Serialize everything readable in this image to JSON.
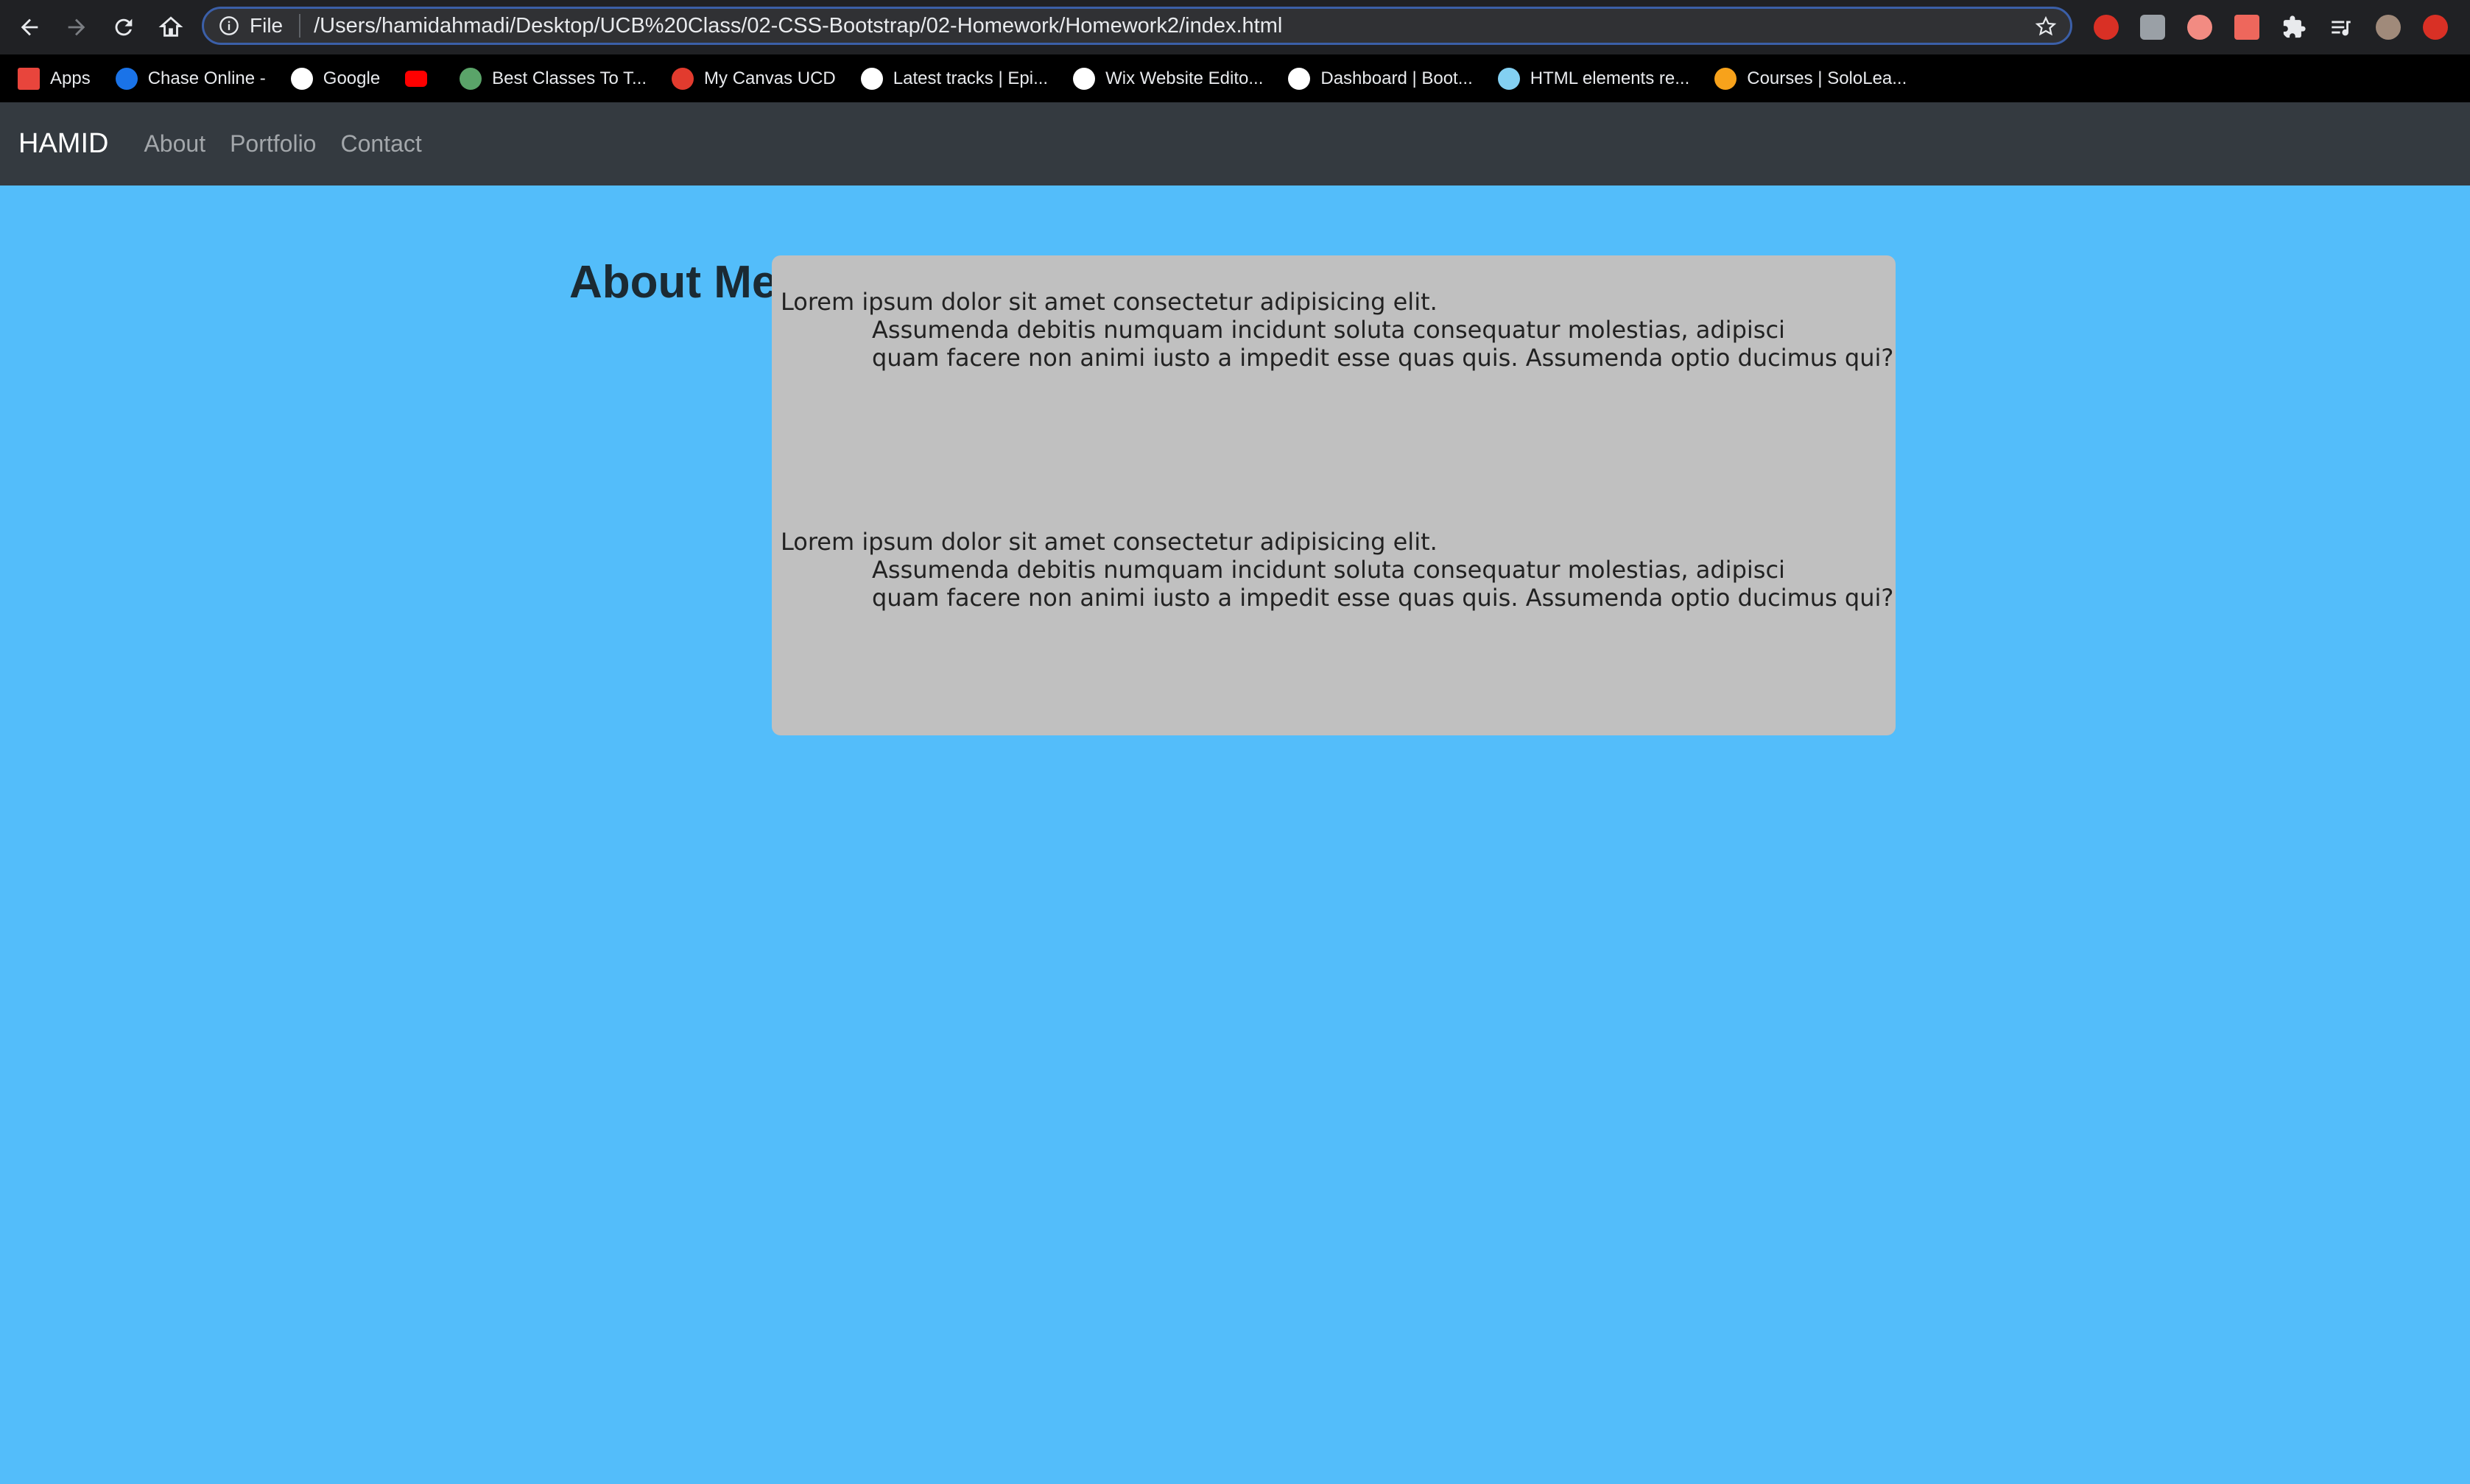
{
  "browser": {
    "scheme": "File",
    "url": "/Users/hamidahmadi/Desktop/UCB%20Class/02-CSS-Bootstrap/02-Homework/Homework2/index.html",
    "bookmarks": [
      {
        "label": "Apps",
        "icon": "apps-grid-icon",
        "color": "#e8453c"
      },
      {
        "label": "Chase Online -",
        "icon": "chase-icon",
        "color": "#1a73e8"
      },
      {
        "label": "Google",
        "icon": "google-icon",
        "color": "#ffffff"
      },
      {
        "label": "",
        "icon": "youtube-icon",
        "color": "#ff0000"
      },
      {
        "label": "Best Classes To T...",
        "icon": "gear-icon",
        "color": "#5aa469"
      },
      {
        "label": "My Canvas UCD",
        "icon": "canvas-icon",
        "color": "#e23b2e"
      },
      {
        "label": "Latest tracks | Epi...",
        "icon": "epidemic-icon",
        "color": "#ffffff"
      },
      {
        "label": "Wix Website Edito...",
        "icon": "wix-icon",
        "color": "#ffffff"
      },
      {
        "label": "Dashboard | Boot...",
        "icon": "globe-icon",
        "color": "#ffffff"
      },
      {
        "label": "HTML elements re...",
        "icon": "mdn-icon",
        "color": "#83d0f2"
      },
      {
        "label": "Courses | SoloLea...",
        "icon": "sololearn-icon",
        "color": "#f7a21b"
      }
    ]
  },
  "site": {
    "brand": "HAMID",
    "nav": [
      "About",
      "Portfolio",
      "Contact"
    ],
    "heading": "About Me",
    "paragraphs": [
      {
        "line1": "Lorem ipsum dolor sit amet consectetur adipisicing elit.",
        "line2": "Assumenda debitis numquam incidunt soluta consequatur molestias, adipisci",
        "line3": "quam facere non animi iusto a impedit esse quas quis. Assumenda optio ducimus qui?"
      },
      {
        "line1": "Lorem ipsum dolor sit amet consectetur adipisicing elit.",
        "line2": "Assumenda debitis numquam incidunt soluta consequatur molestias, adipisci",
        "line3": "quam facere non animi iusto a impedit esse quas quis. Assumenda optio ducimus qui?"
      }
    ]
  }
}
